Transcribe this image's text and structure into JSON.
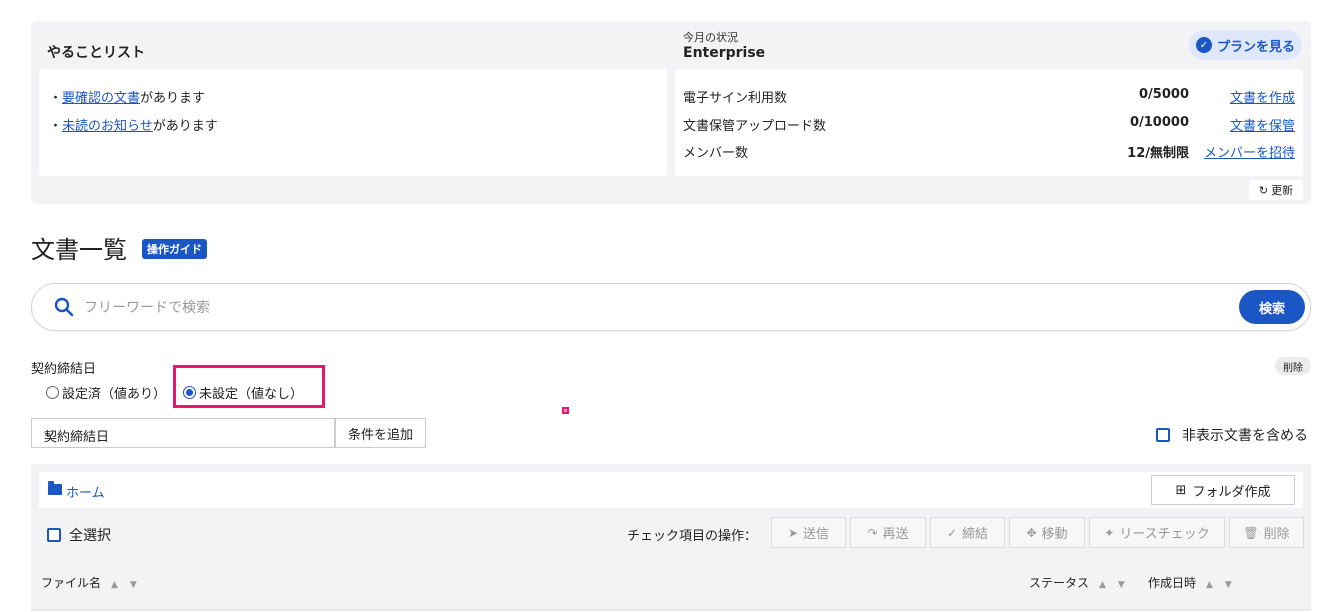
{
  "todo": {
    "title": "やることリスト",
    "items": [
      {
        "bullet": "・",
        "link": "要確認の文書",
        "suffix": "があります"
      },
      {
        "bullet": "・",
        "link": "未読のお知らせ",
        "suffix": "があります"
      }
    ]
  },
  "status": {
    "label": "今月の状況",
    "plan": "Enterprise",
    "plan_button": "プランを見る",
    "rows": [
      {
        "label": "電子サイン利用数",
        "value": "0/5000",
        "link": "文書を作成"
      },
      {
        "label": "文書保管アップロード数",
        "value": "0/10000",
        "link": "文書を保管"
      },
      {
        "label": "メンバー数",
        "value": "12/無制限",
        "link": "メンバーを招待"
      }
    ],
    "refresh": "更新"
  },
  "documents": {
    "title": "文書一覧",
    "guide_badge": "操作ガイド"
  },
  "search": {
    "placeholder": "フリーワードで検索",
    "value": "",
    "button": "検索"
  },
  "filter": {
    "label": "契約締結日",
    "delete": "削除",
    "option_set": "設定済（値あり）",
    "option_unset": "未設定（値なし）",
    "selected": "option_unset",
    "field_select": "契約締結日",
    "add_condition": "条件を追加",
    "include_hidden": "非表示文書を含める"
  },
  "list": {
    "home": "ホーム",
    "new_folder": "フォルダ作成",
    "select_all": "全選択",
    "ops_label": "チェック項目の操作：",
    "ops": {
      "send": "送信",
      "resend": "再送",
      "conclude": "締結",
      "move": "移動",
      "lease_check": "リースチェック",
      "delete": "削除"
    },
    "columns": {
      "file_name": "ファイル名",
      "status": "ステータス",
      "created": "作成日時"
    }
  },
  "colors": {
    "accent": "#1a56c4",
    "highlight": "#e5176e"
  }
}
